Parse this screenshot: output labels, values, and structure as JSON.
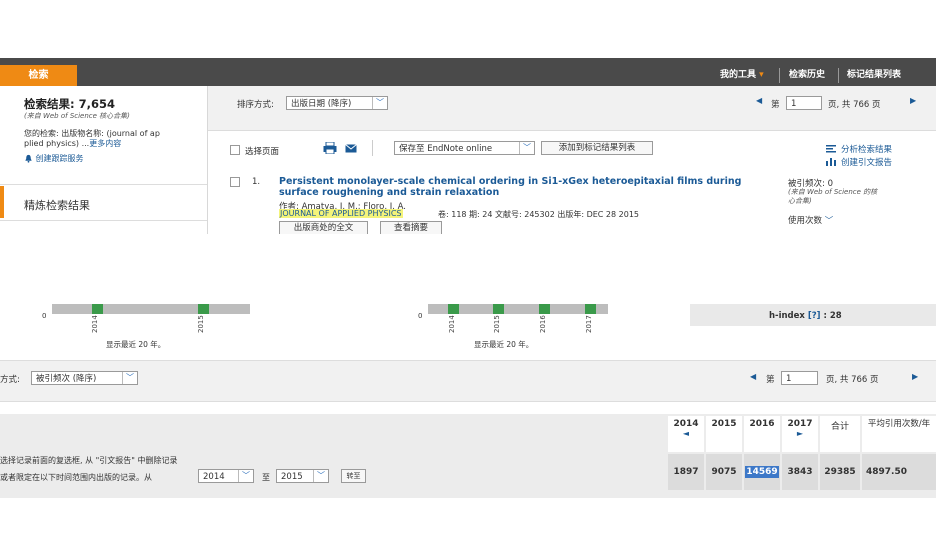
{
  "top": {
    "nav": {
      "search_tab": "检索",
      "my_tools": "我的工具",
      "my_tools_caret": "▾",
      "history": "检索历史",
      "marked_list": "标记结果列表"
    },
    "sidebar": {
      "results_label": "检索结果: 7,654",
      "results_source": "(来自 Web of Science 核心合集)",
      "query_line1": "您的检索: 出版物名称: (journal of ap",
      "query_line2a": "plied physics) ...",
      "query_more": "更多内容",
      "create_alert": "创建跟踪服务",
      "refine": "精炼检索结果"
    },
    "sort": {
      "label": "排序方式:",
      "value": "出版日期 (降序)",
      "page_label": "第",
      "page_value": "1",
      "page_total": "页, 共  766  页"
    },
    "toolbar": {
      "select_page": "选择页面",
      "save_to": "保存至 EndNote online",
      "add_marked": "添加到标记结果列表",
      "analyze": "分析检索结果",
      "citation_report": "创建引文报告"
    },
    "record": {
      "index": "1.",
      "title_line1": "Persistent monolayer-scale chemical ordering in Si1-xGex heterоepitaxial films during",
      "title_line2": "surface roughening and strain relaxation",
      "authors": "作者: Amatya, J. M.; Floro, J. A.",
      "journal": "JOURNAL OF APPLIED PHYSICS",
      "meta": "卷: 118  期: 24  文献号: 245302  出版年: DEC 28 2015",
      "full_text_btn": "出版商处的全文",
      "abstract_btn": "查看摘要",
      "cited_label": "被引频次: 0",
      "cited_source1": "(来自 Web of Science 的核",
      "cited_source2": "心合集)",
      "usage": "使用次数"
    }
  },
  "bottom": {
    "chart1": {
      "zero": "0",
      "years": [
        "2014",
        "2015"
      ],
      "footer": "显示最近 20 年。"
    },
    "chart2": {
      "zero": "0",
      "years": [
        "2014",
        "2015",
        "2016",
        "2017"
      ],
      "footer": "显示最近 20 年。"
    },
    "hindex": {
      "label": "h-index",
      "help": "[?]",
      "value": ": 28"
    },
    "sort": {
      "label": "方式:",
      "value": "被引频次 (降序)",
      "page_label": "第",
      "page_value": "1",
      "page_total": "页, 共  766  页"
    },
    "filter": {
      "line1": "选择记录前面的复选框, 从 \"引文报告\" 中删除记录",
      "line2": "或者限定在以下时间范围内出版的记录。从",
      "from_year": "2014",
      "to_label": "至",
      "to_year": "2015",
      "go": "转至"
    },
    "table": {
      "years": [
        "2014",
        "2015",
        "2016",
        "2017"
      ],
      "prev_arrow": "◄",
      "next_arrow": "►",
      "total_label": "合计",
      "avg_label": "平均引用次数/年",
      "values": [
        "1897",
        "9075",
        "14569",
        "3843"
      ],
      "total": "29385",
      "avg": "4897.50"
    }
  },
  "colors": {
    "accent_orange": "#ef8a14",
    "topbar": "#4a4a4a",
    "link_blue": "#1b5a96",
    "chart_green": "#3a9a4a",
    "highlight_yellow": "#f4f47a"
  }
}
